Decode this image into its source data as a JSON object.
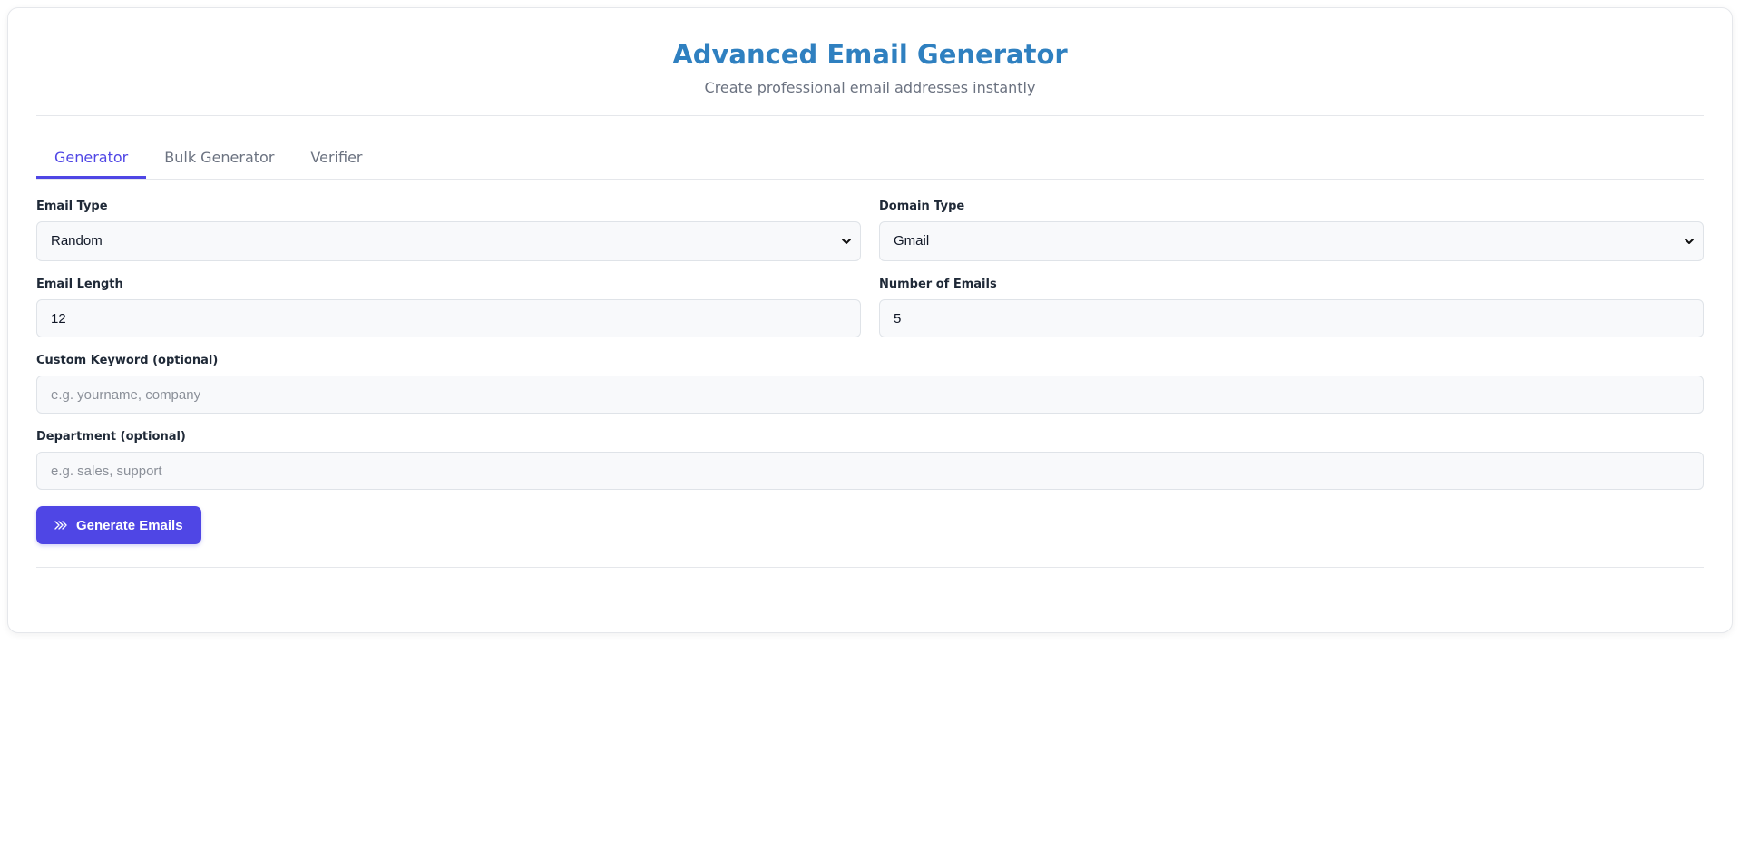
{
  "header": {
    "title": "Advanced Email Generator",
    "subtitle": "Create professional email addresses instantly"
  },
  "tabs": [
    {
      "label": "Generator",
      "active": true
    },
    {
      "label": "Bulk Generator",
      "active": false
    },
    {
      "label": "Verifier",
      "active": false
    }
  ],
  "form": {
    "email_type": {
      "label": "Email Type",
      "value": "Random"
    },
    "domain_type": {
      "label": "Domain Type",
      "value": "Gmail"
    },
    "email_length": {
      "label": "Email Length",
      "value": "12"
    },
    "number_of_emails": {
      "label": "Number of Emails",
      "value": "5"
    },
    "custom_keyword": {
      "label": "Custom Keyword (optional)",
      "placeholder": "e.g. yourname, company"
    },
    "department": {
      "label": "Department (optional)",
      "placeholder": "e.g. sales, support"
    }
  },
  "generate_button": {
    "label": "Generate Emails",
    "icon": "double-chevron-right-icon"
  },
  "colors": {
    "accent": "#4f46e5",
    "title": "#2f80c0"
  }
}
